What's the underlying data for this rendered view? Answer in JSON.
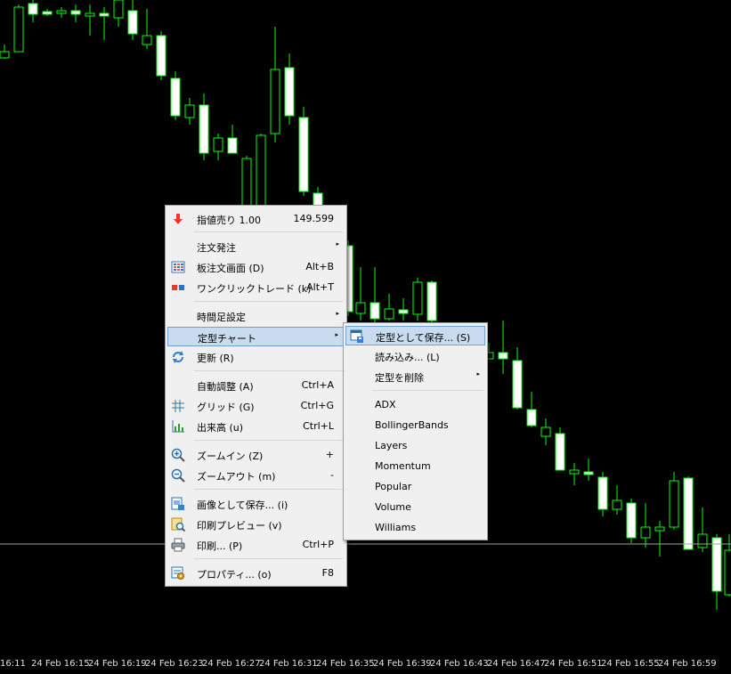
{
  "chart": {
    "background": "#000000",
    "candle_color": "#00ff00",
    "bull_body": "#000000",
    "bear_body": "#ffffff",
    "price_line_color": "#9aa89a",
    "x_axis_labels": [
      "16:11",
      "24 Feb 16:15",
      "24 Feb 16:19",
      "24 Feb 16:23",
      "24 Feb 16:27",
      "24 Feb 16:31",
      "24 Feb 16:35",
      "24 Feb 16:39",
      "24 Feb 16:43",
      "24 Feb 16:47",
      "24 Feb 16:51",
      "24 Feb 16:55",
      "24 Feb 16:59"
    ]
  },
  "context_menu": {
    "sell_limit": {
      "label": "指値売り 1.00",
      "price": "149.599",
      "icon": "red-down-arrow-icon"
    },
    "place_order": {
      "label": "注文発注"
    },
    "order_board": {
      "label": "板注文画面 (D)",
      "shortcut": "Alt+B",
      "icon": "order-board-icon"
    },
    "one_click": {
      "label": "ワンクリックトレード (k)",
      "shortcut": "Alt+T",
      "icon": "one-click-trading-icon"
    },
    "timeframe": {
      "label": "時間足設定"
    },
    "templates": {
      "label": "定型チャート"
    },
    "refresh": {
      "label": "更新 (R)",
      "icon": "refresh-icon"
    },
    "autoscroll": {
      "label": "自動調整 (A)",
      "shortcut": "Ctrl+A"
    },
    "grid": {
      "label": "グリッド (G)",
      "shortcut": "Ctrl+G",
      "icon": "grid-icon"
    },
    "volume": {
      "label": "出来高 (u)",
      "shortcut": "Ctrl+L",
      "icon": "volume-icon"
    },
    "zoom_in": {
      "label": "ズームイン (Z)",
      "shortcut": "+",
      "icon": "zoom-in-icon"
    },
    "zoom_out": {
      "label": "ズームアウト (m)",
      "shortcut": "-",
      "icon": "zoom-out-icon"
    },
    "save_image": {
      "label": "画像として保存... (i)",
      "icon": "save-image-icon"
    },
    "print_preview": {
      "label": "印刷プレビュー (v)",
      "icon": "print-preview-icon"
    },
    "print": {
      "label": "印刷... (P)",
      "shortcut": "Ctrl+P",
      "icon": "printer-icon"
    },
    "properties": {
      "label": "プロパティ... (o)",
      "shortcut": "F8",
      "icon": "properties-icon"
    }
  },
  "template_submenu": {
    "save_as": {
      "label": "定型として保存... (S)",
      "icon": "save-template-icon"
    },
    "load": {
      "label": "読み込み... (L)"
    },
    "delete": {
      "label": "定型を削除"
    },
    "templates": [
      "ADX",
      "BollingerBands",
      "Layers",
      "Momentum",
      "Popular",
      "Volume",
      "Williams"
    ]
  },
  "submenu_arrow": "▸"
}
